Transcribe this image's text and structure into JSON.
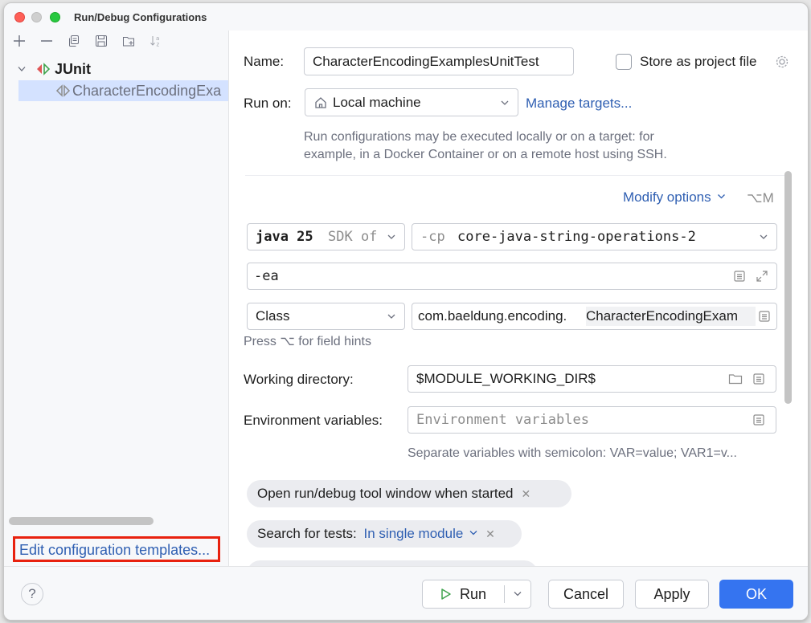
{
  "window": {
    "title": "Run/Debug Configurations"
  },
  "tree": {
    "root_label": "JUnit",
    "item_label": "CharacterEncodingExa"
  },
  "left_footer": {
    "edit_templates": "Edit configuration templates..."
  },
  "form": {
    "name_label": "Name:",
    "name_value": "CharacterEncodingExamplesUnitTest",
    "store_label": "Store as project file",
    "run_on_label": "Run on:",
    "run_on_value": "Local machine",
    "manage_targets": "Manage targets...",
    "run_on_hint_1": "Run configurations may be executed locally or on a target: for",
    "run_on_hint_2": "example, in a Docker Container or on a remote host using SSH.",
    "modify_options": "Modify options",
    "modify_shortcut": "⌥M",
    "jre_value": "java 25",
    "jre_suffix": "SDK of",
    "cp_prefix": "-cp",
    "cp_value": "core-java-string-operations-2",
    "vm_options": "-ea",
    "test_kind": "Class",
    "class_prefix": "com.baeldung.encoding.",
    "class_name": "CharacterEncodingExam",
    "field_hints": "Press ⌥ for field hints",
    "workdir_label": "Working directory:",
    "workdir_value": "$MODULE_WORKING_DIR$",
    "env_label": "Environment variables:",
    "env_placeholder": "Environment variables",
    "env_hint": "Separate variables with semicolon: VAR=value; VAR1=v...",
    "chip_open_window": "Open run/debug tool window when started",
    "chip_search_label": "Search for tests:",
    "chip_search_value": "In single module"
  },
  "footer": {
    "help": "?",
    "run": "Run",
    "cancel": "Cancel",
    "apply": "Apply",
    "ok": "OK"
  },
  "colors": {
    "accent": "#3574f0",
    "link": "#2f5fb2",
    "highlight_border": "#e8210e",
    "selection": "#d4e2ff"
  }
}
